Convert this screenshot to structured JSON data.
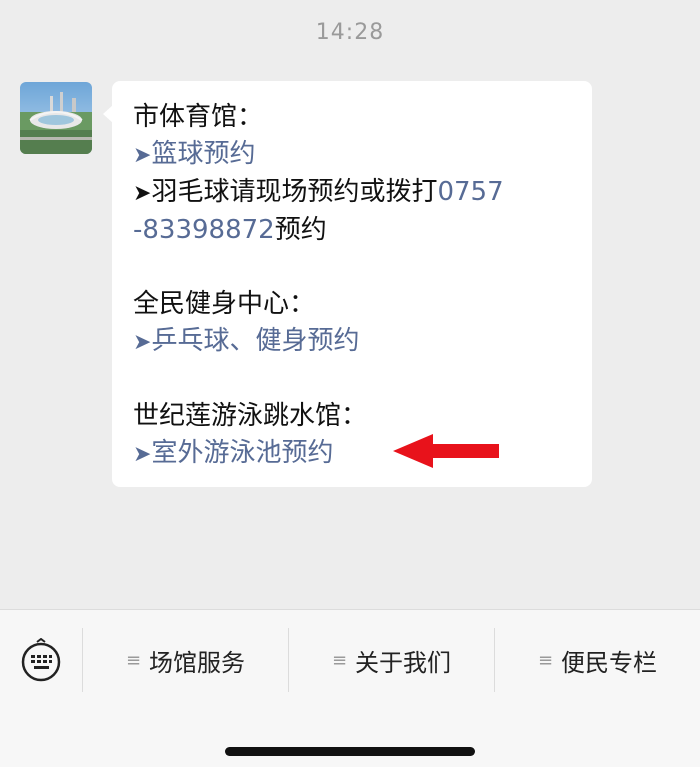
{
  "status": {
    "time": "14:28"
  },
  "message": {
    "avatar_icon": "stadium-photo",
    "sections": [
      {
        "heading": "市体育馆：",
        "link_basketball": "篮球预约",
        "badminton_text": "羽毛球请现场预约或拨打",
        "phone_part1": "0757",
        "phone_part2": "-83398872",
        "badminton_suffix": "预约"
      },
      {
        "heading": "全民健身中心：",
        "link_pingpong": "乒乓球、健身预约"
      },
      {
        "heading": "世纪莲游泳跳水馆：",
        "link_pool": "室外游泳池预约"
      }
    ],
    "arrow_glyph": "➤"
  },
  "colors": {
    "link": "#576b95",
    "annotation_arrow": "#e8121b",
    "background": "#ededed"
  },
  "menu": {
    "keyboard_icon": "keyboard-icon",
    "items": [
      {
        "label": "场馆服务"
      },
      {
        "label": "关于我们"
      },
      {
        "label": "便民专栏"
      }
    ],
    "item_icon": "≡"
  }
}
